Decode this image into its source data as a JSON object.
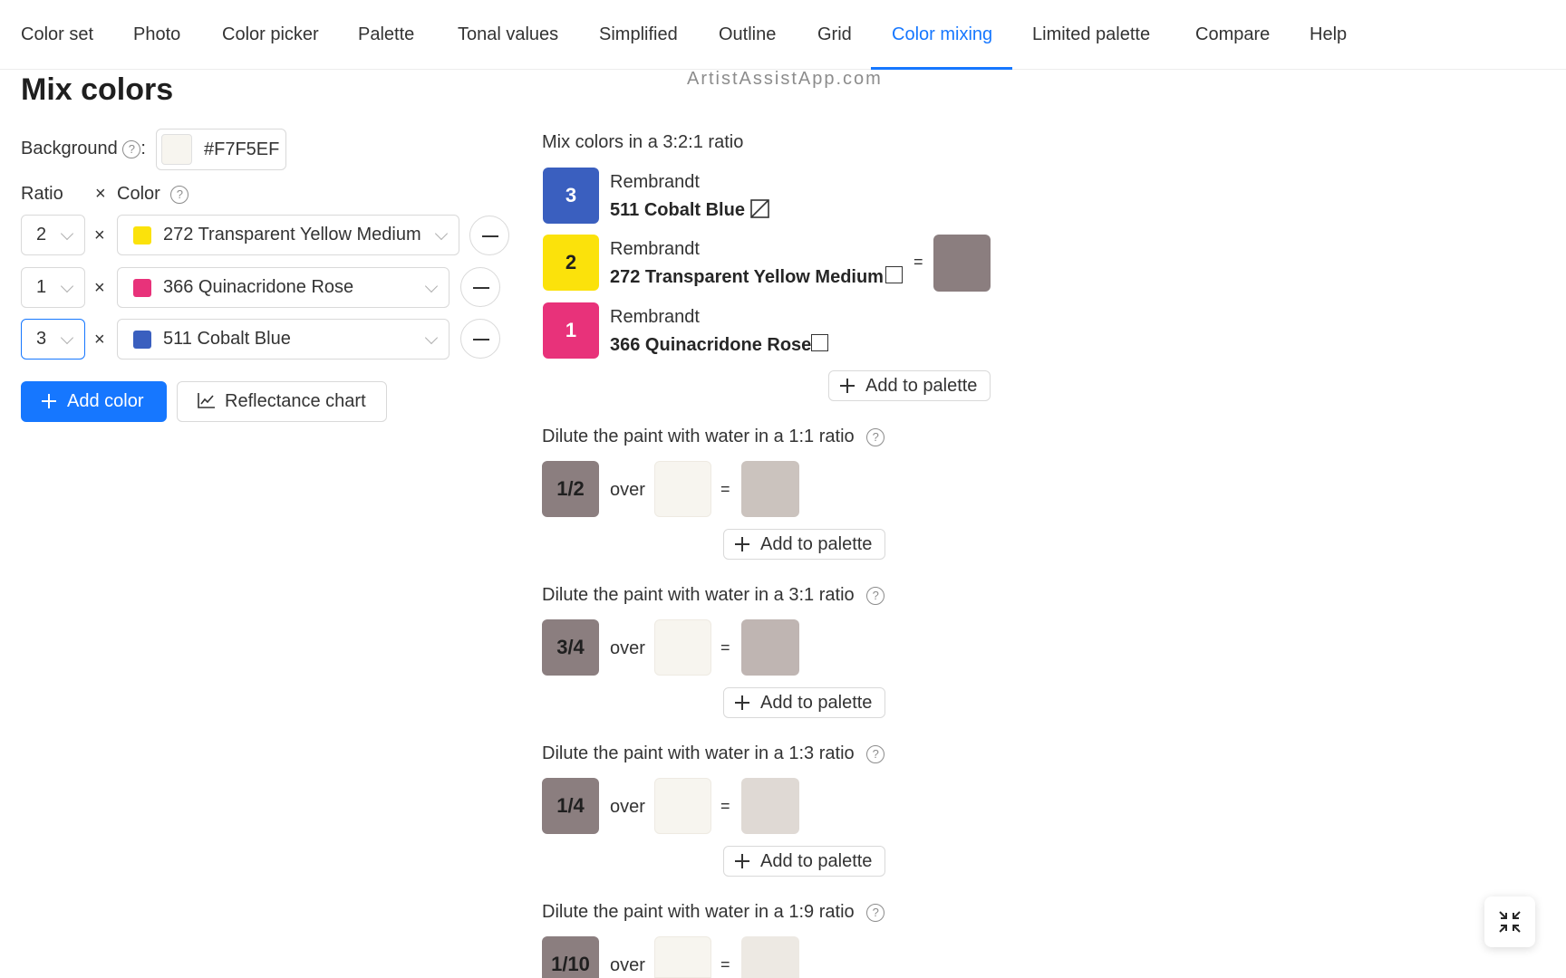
{
  "nav": {
    "tabs": [
      {
        "label": "Color set"
      },
      {
        "label": "Photo"
      },
      {
        "label": "Color picker"
      },
      {
        "label": "Palette"
      },
      {
        "label": "Tonal values"
      },
      {
        "label": "Simplified"
      },
      {
        "label": "Outline"
      },
      {
        "label": "Grid"
      },
      {
        "label": "Color mixing",
        "active": true
      },
      {
        "label": "Limited palette"
      },
      {
        "label": "Compare"
      },
      {
        "label": "Help"
      }
    ]
  },
  "watermark": "ArtistAssistApp.com",
  "page_title": "Mix colors",
  "background": {
    "label": "Background",
    "colon": ":",
    "value": "#F7F5EF",
    "color": "#F7F5EF"
  },
  "table_head": {
    "ratio": "Ratio",
    "times": "×",
    "color": "Color"
  },
  "rows": [
    {
      "ratio": "2",
      "times": "×",
      "color_label": "272 Transparent Yellow Medium",
      "swatch": "#FBE20B"
    },
    {
      "ratio": "1",
      "times": "×",
      "color_label": "366 Quinacridone Rose",
      "swatch": "#E8327A"
    },
    {
      "ratio": "3",
      "times": "×",
      "color_label": "511 Cobalt Blue",
      "swatch": "#3A5FBF",
      "focused": true
    }
  ],
  "buttons": {
    "add_color": "Add color",
    "reflectance_chart": "Reflectance chart"
  },
  "mix": {
    "heading": "Mix colors in a 3:2:1 ratio",
    "items": [
      {
        "parts": "3",
        "brand": "Rembrandt",
        "name": "511 Cobalt Blue",
        "color": "#3A5FBF",
        "text_color": "#ffffff"
      },
      {
        "parts": "2",
        "brand": "Rembrandt",
        "name": "272 Transparent Yellow Medium",
        "color": "#FBE20B",
        "text_color": "#1f1f1f"
      },
      {
        "parts": "1",
        "brand": "Rembrandt",
        "name": "366 Quinacridone Rose",
        "color": "#E8327A",
        "text_color": "#ffffff"
      }
    ],
    "equals": "=",
    "result_color": "#8B7E7F",
    "add_to_palette": "Add to palette"
  },
  "dilutions": [
    {
      "heading": "Dilute the paint with water in a 1:1 ratio",
      "fraction": "1/2",
      "over": "over",
      "equals": "=",
      "result_color": "#CBC3BE",
      "add_to_palette": "Add to palette"
    },
    {
      "heading": "Dilute the paint with water in a 3:1 ratio",
      "fraction": "3/4",
      "over": "over",
      "equals": "=",
      "result_color": "#BFB5B2",
      "add_to_palette": "Add to palette"
    },
    {
      "heading": "Dilute the paint with water in a 1:3 ratio",
      "fraction": "1/4",
      "over": "over",
      "equals": "=",
      "result_color": "#DFD9D4",
      "add_to_palette": "Add to palette"
    },
    {
      "heading": "Dilute the paint with water in a 1:9 ratio",
      "fraction": "1/10",
      "over": "over",
      "equals": "=",
      "result_color": "#EDE9E3"
    }
  ]
}
